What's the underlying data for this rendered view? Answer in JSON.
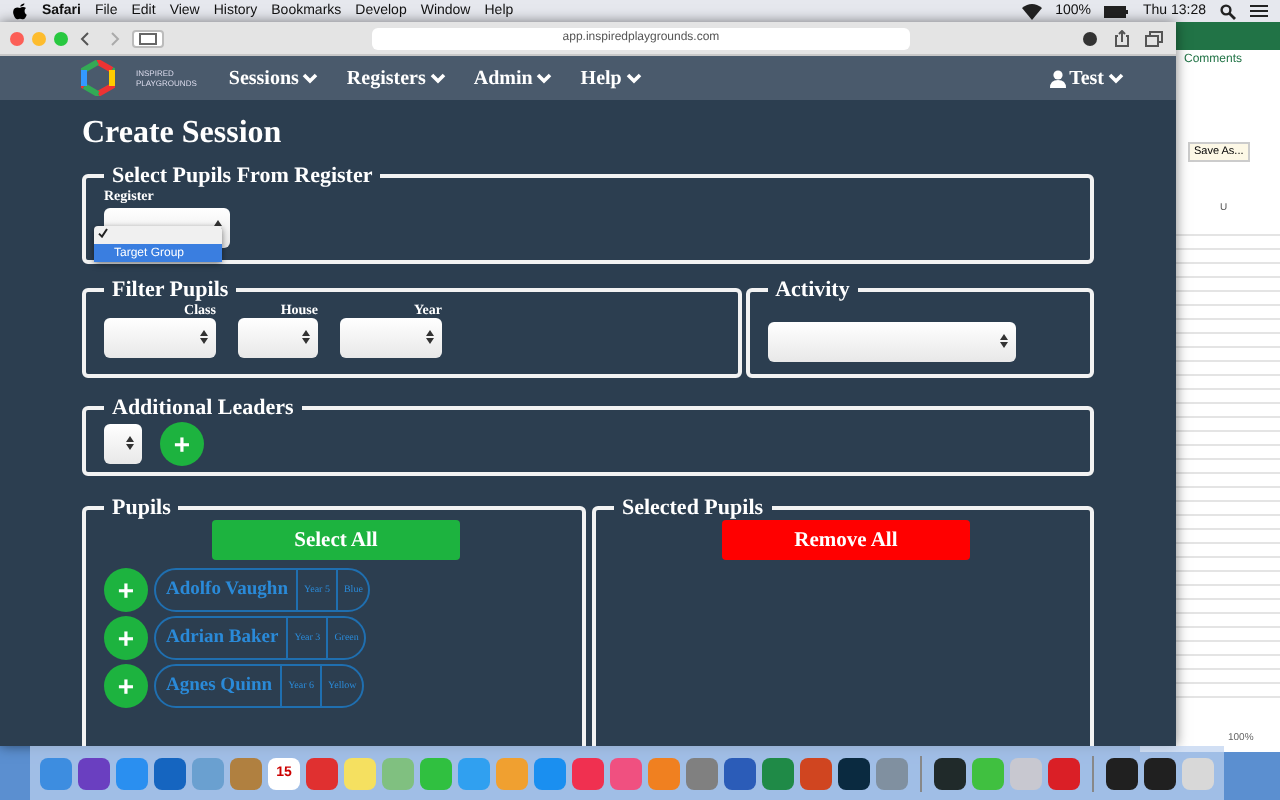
{
  "menu_bar": {
    "app": "Safari",
    "items": [
      "File",
      "Edit",
      "View",
      "History",
      "Bookmarks",
      "Develop",
      "Window",
      "Help"
    ],
    "battery": "100%",
    "clock": "Thu 13:28"
  },
  "browser": {
    "url": "app.inspiredplaygrounds.com"
  },
  "nav": {
    "logo_lines": [
      "INSPIRED",
      "PLAYGROUNDS"
    ],
    "items": [
      "Sessions",
      "Registers",
      "Admin",
      "Help"
    ],
    "user": "Test"
  },
  "page": {
    "title": "Create Session",
    "register_section": {
      "legend": "Select Pupils From Register",
      "label": "Register",
      "dropdown": [
        {
          "kind": "blank",
          "checked": true,
          "highlighted": false
        },
        {
          "kind": "option",
          "label": "Target Group",
          "checked": false,
          "highlighted": true
        }
      ]
    },
    "filter_section": {
      "legend": "Filter Pupils",
      "filters": [
        "Class",
        "House",
        "Year"
      ]
    },
    "activity_section": {
      "legend": "Activity"
    },
    "leaders_section": {
      "legend": "Additional Leaders",
      "add": "+"
    },
    "pupils_section": {
      "legend": "Pupils",
      "button": "Select All",
      "pupils": [
        {
          "name": "Adolfo Vaughn",
          "year": "Year 5",
          "house": "Blue"
        },
        {
          "name": "Adrian Baker",
          "year": "Year 3",
          "house": "Green"
        },
        {
          "name": "Agnes Quinn",
          "year": "Year 6",
          "house": "Yellow"
        }
      ]
    },
    "selected_section": {
      "legend": "Selected Pupils",
      "button": "Remove All"
    }
  },
  "excel": {
    "comments": "Comments",
    "save_as": "Save As...",
    "column": "U",
    "zoom": "100%"
  },
  "dock": [
    {
      "kind": "app",
      "color": "#3d8de0"
    },
    {
      "kind": "app",
      "color": "#6a3fc0"
    },
    {
      "kind": "app",
      "color": "#2a8ff0"
    },
    {
      "kind": "app",
      "color": "#1565c0"
    },
    {
      "kind": "app",
      "color": "#6aa0d0"
    },
    {
      "kind": "app",
      "color": "#b08040"
    },
    {
      "kind": "calendar",
      "color": "#ffffff",
      "label": "15"
    },
    {
      "kind": "app",
      "color": "#e03030"
    },
    {
      "kind": "app",
      "color": "#f5e060"
    },
    {
      "kind": "app",
      "color": "#80c080"
    },
    {
      "kind": "app",
      "color": "#30c040"
    },
    {
      "kind": "app",
      "color": "#30a0f0"
    },
    {
      "kind": "app",
      "color": "#f0a030"
    },
    {
      "kind": "app",
      "color": "#1a8ff0"
    },
    {
      "kind": "app",
      "color": "#f03050"
    },
    {
      "kind": "app",
      "color": "#f05080"
    },
    {
      "kind": "app",
      "color": "#f08020"
    },
    {
      "kind": "app",
      "color": "#808080"
    },
    {
      "kind": "app",
      "color": "#2b5cb8"
    },
    {
      "kind": "app",
      "color": "#1f8a47"
    },
    {
      "kind": "app",
      "color": "#d04520"
    },
    {
      "kind": "app",
      "color": "#0a2a40"
    },
    {
      "kind": "app",
      "color": "#8090a0"
    },
    {
      "kind": "separator"
    },
    {
      "kind": "app",
      "color": "#202a2a"
    },
    {
      "kind": "app",
      "color": "#40c040"
    },
    {
      "kind": "app",
      "color": "#c8c8d0"
    },
    {
      "kind": "app",
      "color": "#da1f26"
    },
    {
      "kind": "separator"
    },
    {
      "kind": "app",
      "color": "#202020"
    },
    {
      "kind": "app",
      "color": "#202020"
    },
    {
      "kind": "app",
      "color": "#d8d8d8"
    }
  ]
}
